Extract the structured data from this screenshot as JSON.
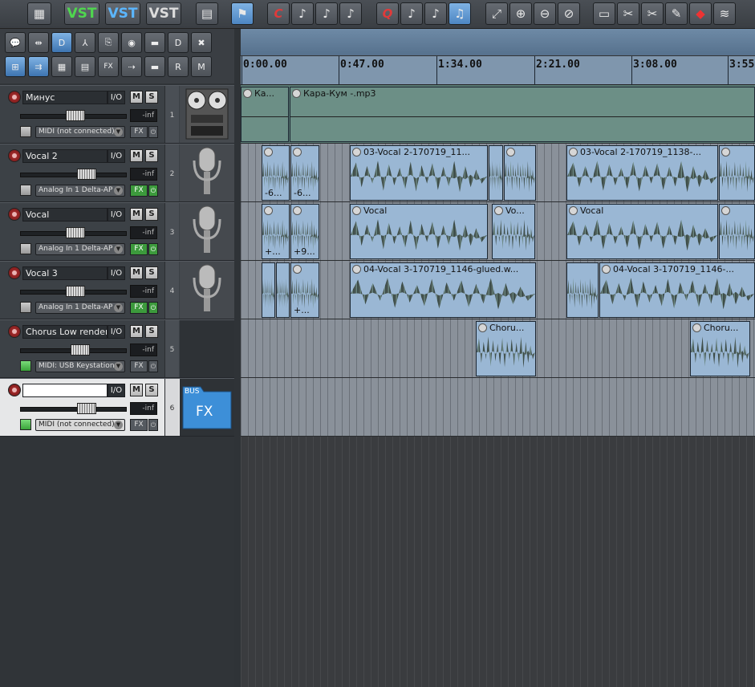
{
  "toolbar": {
    "vst1": "VST",
    "vst2": "VST",
    "vst3": "VST",
    "icons": [
      "chip-icon",
      "vst-green-icon",
      "vst-blue-icon",
      "vst-gray-icon",
      "clapper-icon",
      "walk-icon",
      "metronome-icon",
      "note-icon",
      "note-icon",
      "note-icon",
      "quantize-icon",
      "note-icon",
      "note-icon",
      "note-active-icon",
      "zoom-fit-icon",
      "zoom-in-icon",
      "zoom-out-icon",
      "zoom-reset-icon",
      "split-icon",
      "cut-icon",
      "cut-x-icon",
      "marker-icon",
      "eraser-icon",
      "waveform-icon"
    ]
  },
  "ruler": {
    "labels": [
      "0:00.00",
      "0:47.00",
      "1:34.00",
      "2:21.00",
      "3:08.00",
      "3:55"
    ]
  },
  "tracks": [
    {
      "name": "Минус",
      "io": "I/O",
      "m": "M",
      "s": "S",
      "meter": "-inf",
      "input": "MIDI (not connected)",
      "fx": "FX",
      "fx_on": false,
      "num": "1"
    },
    {
      "name": "Vocal 2",
      "io": "I/O",
      "m": "M",
      "s": "S",
      "meter": "-inf",
      "input": "Analog In 1 Delta-AP",
      "fx": "FX",
      "fx_on": true,
      "num": "2"
    },
    {
      "name": "Vocal",
      "io": "I/O",
      "m": "M",
      "s": "S",
      "meter": "-inf",
      "input": "Analog In 1 Delta-AP",
      "fx": "FX",
      "fx_on": true,
      "num": "3"
    },
    {
      "name": "Vocal 3",
      "io": "I/O",
      "m": "M",
      "s": "S",
      "meter": "-inf",
      "input": "Analog In 1 Delta-AP",
      "fx": "FX",
      "fx_on": true,
      "num": "4"
    },
    {
      "name": "Chorus Low render",
      "io": "I/O",
      "m": "M",
      "s": "S",
      "meter": "-inf",
      "input": "MIDI: USB Keystation",
      "fx": "FX",
      "fx_on": false,
      "num": "5"
    },
    {
      "name": "",
      "io": "I/O",
      "m": "M",
      "s": "S",
      "meter": "-inf",
      "input": "MIDI (not connected)",
      "fx": "FX",
      "fx_on": false,
      "num": "6"
    }
  ],
  "bus_folder": {
    "top": "BUS",
    "label": "FX"
  },
  "items": {
    "t1": [
      {
        "label": "Ка..."
      },
      {
        "label": "Кара-Кум -.mp3"
      }
    ],
    "t2": [
      {
        "label": "",
        "gain": "-6..."
      },
      {
        "label": "",
        "gain": "-6..."
      },
      {
        "label": "03-Vocal 2-170719_11..."
      },
      {
        "label": ""
      },
      {
        "label": ""
      },
      {
        "label": "03-Vocal 2-170719_1138-..."
      },
      {
        "label": ""
      }
    ],
    "t3": [
      {
        "label": "",
        "gain": "+..."
      },
      {
        "label": "",
        "gain": "+9..."
      },
      {
        "label": "Vocal"
      },
      {
        "label": "Vo..."
      },
      {
        "label": "Vocal"
      },
      {
        "label": ""
      },
      {
        "label": ""
      }
    ],
    "t4": [
      {
        "label": ""
      },
      {
        "label": ""
      },
      {
        "label": "",
        "gain": "+..."
      },
      {
        "label": "04-Vocal 3-170719_1146-glued.w..."
      },
      {
        "label": ""
      },
      {
        "label": "04-Vocal 3-170719_1146-..."
      }
    ],
    "t5": [
      {
        "label": "Choru..."
      },
      {
        "label": "Choru..."
      }
    ]
  }
}
